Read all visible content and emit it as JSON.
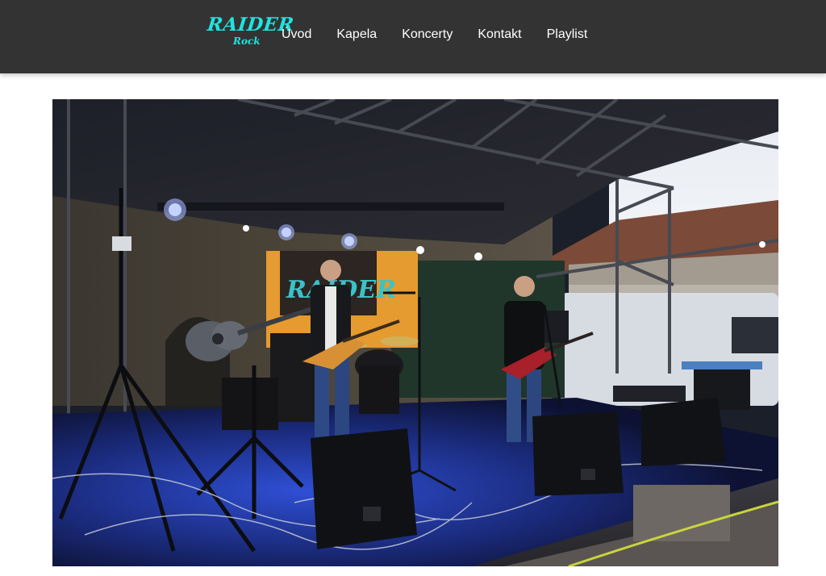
{
  "brand": {
    "logo_line1": "RAIDER",
    "logo_line2": "Rock",
    "accent_color": "#1fe3e0",
    "header_bg": "#333333"
  },
  "nav": {
    "items": [
      {
        "label": "Úvod"
      },
      {
        "label": "Kapela"
      },
      {
        "label": "Koncerty"
      },
      {
        "label": "Kontakt"
      },
      {
        "label": "Playlist"
      }
    ]
  },
  "hero": {
    "banner_text": "RAIDER"
  }
}
